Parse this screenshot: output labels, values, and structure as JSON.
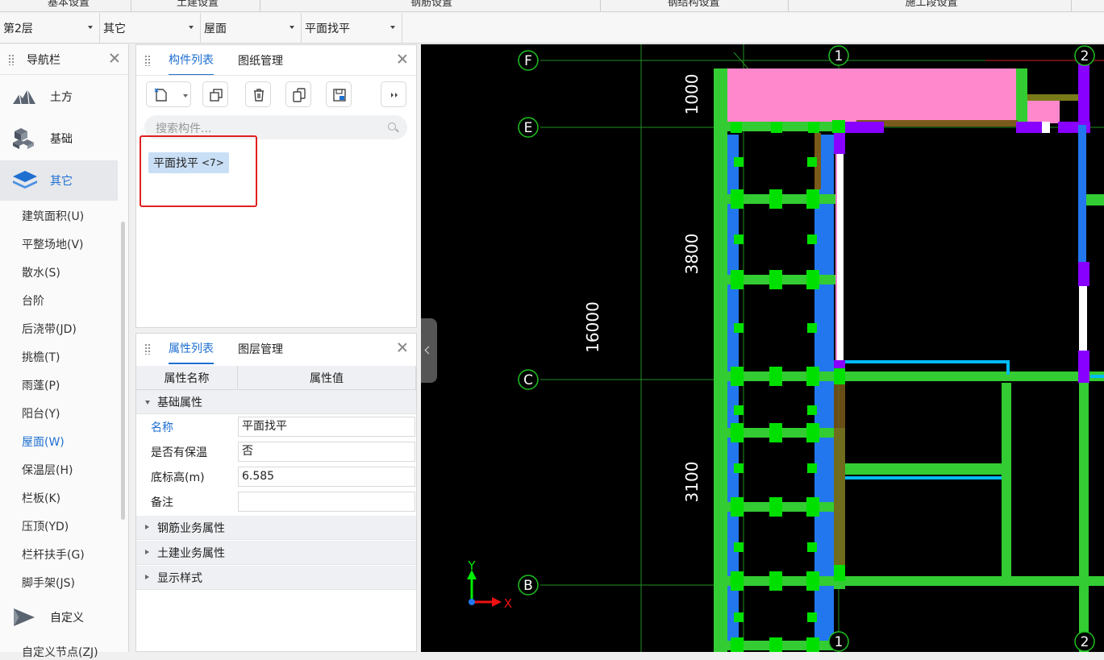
{
  "header_sections": [
    "基本设置",
    "土建设置",
    "钢筋设置",
    "钢结构设置",
    "施工段设置"
  ],
  "toolbar": {
    "floor": "第2层",
    "category": "其它",
    "type": "屋面",
    "component": "平面找平"
  },
  "nav": {
    "title": "导航栏",
    "categories": [
      {
        "label": "土方",
        "icon": "earthwork-icon"
      },
      {
        "label": "基础",
        "icon": "foundation-icon"
      },
      {
        "label": "其它",
        "icon": "layers-icon"
      },
      {
        "label": "自定义",
        "icon": "custom-icon"
      }
    ],
    "items": [
      "建筑面积(U)",
      "平整场地(V)",
      "散水(S)",
      "台阶",
      "后浇带(JD)",
      "挑檐(T)",
      "雨蓬(P)",
      "阳台(Y)",
      "屋面(W)",
      "保温层(H)",
      "栏板(K)",
      "压顶(YD)",
      "栏杆扶手(G)",
      "脚手架(JS)"
    ],
    "active_item": "屋面(W)",
    "cut_item": "自定义节点(ZJ)"
  },
  "component_panel": {
    "tabs": [
      "构件列表",
      "图纸管理"
    ],
    "search_placeholder": "搜索构件...",
    "components": [
      {
        "name": "平面找平",
        "count": "<7>"
      }
    ]
  },
  "property_panel": {
    "tabs": [
      "属性列表",
      "图层管理"
    ],
    "columns": [
      "属性名称",
      "属性值"
    ],
    "groups": [
      {
        "label": "基础属性",
        "expanded": true,
        "rows": [
          {
            "name": "名称",
            "value": "平面找平"
          },
          {
            "name": "是否有保温",
            "value": "否"
          },
          {
            "name": "底标高(m)",
            "value": "6.585"
          },
          {
            "name": "备注",
            "value": ""
          }
        ]
      },
      {
        "label": "钢筋业务属性",
        "expanded": false
      },
      {
        "label": "土建业务属性",
        "expanded": false
      },
      {
        "label": "显示样式",
        "expanded": false
      }
    ]
  },
  "drawing": {
    "axis_labels": [
      "F",
      "E",
      "C",
      "B",
      "1",
      "2",
      "1",
      "2"
    ],
    "dimensions": [
      "1000",
      "3800",
      "16000",
      "3100"
    ],
    "ucs": {
      "y": "Y",
      "x": "X"
    },
    "colors": {
      "wall": "#33cc33",
      "column": "#00e000",
      "slab": "#2277ee",
      "pink": "#ff88cc",
      "purple": "#8800ff",
      "cyan": "#00bbff",
      "brown": "#7a5a1a"
    }
  }
}
